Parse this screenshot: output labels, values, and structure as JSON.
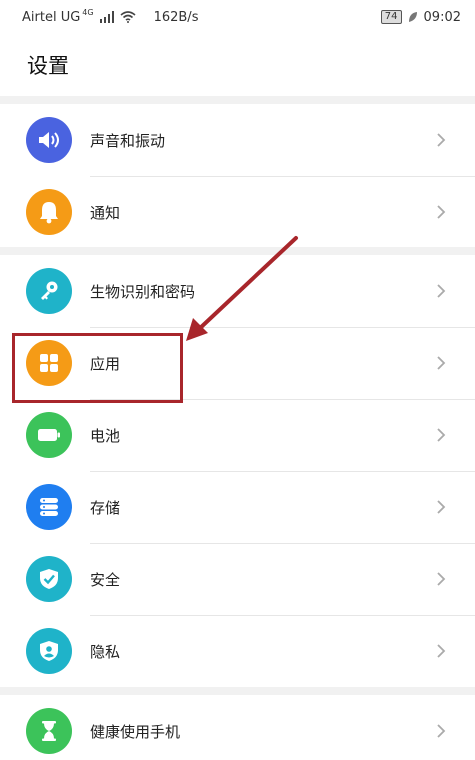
{
  "status_bar": {
    "carrier": "Airtel UG",
    "network": "4G",
    "speed": "162B/s",
    "battery": "74",
    "time": "09:02"
  },
  "header": {
    "title": "设置"
  },
  "settings": [
    {
      "label": "声音和振动",
      "icon": "speaker-icon",
      "color": "#4a63e0"
    },
    {
      "label": "通知",
      "icon": "bell-icon",
      "color": "#f59b16"
    },
    {
      "label": "生物识别和密码",
      "icon": "key-icon",
      "color": "#1fb3c9"
    },
    {
      "label": "应用",
      "icon": "apps-grid-icon",
      "color": "#f59b16"
    },
    {
      "label": "电池",
      "icon": "battery-icon",
      "color": "#3cc35a"
    },
    {
      "label": "存储",
      "icon": "storage-icon",
      "color": "#1f7ef0"
    },
    {
      "label": "安全",
      "icon": "shield-check-icon",
      "color": "#1fb3c9"
    },
    {
      "label": "隐私",
      "icon": "privacy-shield-icon",
      "color": "#1fb3c9"
    },
    {
      "label": "健康使用手机",
      "icon": "hourglass-icon",
      "color": "#3cc35a"
    }
  ],
  "annotation": {
    "color": "#a8262b"
  }
}
